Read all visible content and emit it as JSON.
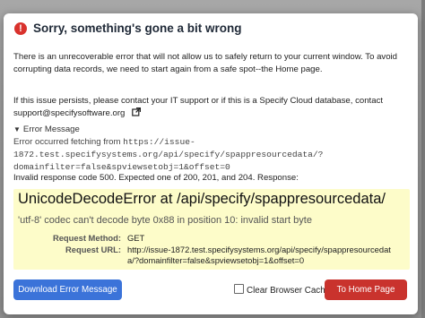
{
  "dialog": {
    "title": "Sorry, something's gone a bit wrong",
    "icon": "error-circle-icon",
    "paragraph1": "There is an unrecoverable error that will not allow us to safely return to your current window. To avoid corrupting data records, we need to start again from a safe spot--the Home page.",
    "paragraph2": "If this issue persists, please contact your IT support or if this is a Specify Cloud database, contact",
    "support_email": "support@specifysoftware.org",
    "details_summary": "Error Message",
    "fetch_prefix": "Error occurred fetching from",
    "fetch_url": "https://issue-1872.test.specifysystems.org/api/specify/spappresourcedata/?domainfilter=false&spviewsetobj=1&offset=0",
    "invalid_response": "Invalid response code 500. Expected one of 200, 201, and 204. Response:",
    "exception": {
      "title": "UnicodeDecodeError at /api/specify/spappresourcedata/",
      "message": "'utf-8' codec can't decode byte 0x88 in position 10: invalid start byte",
      "request_method_label": "Request Method:",
      "request_method_value": "GET",
      "request_url_label": "Request URL:",
      "request_url_value": "http://issue-1872.test.specifysystems.org/api/specify/spappresourcedata/?domainfilter=false&spviewsetobj=1&offset=0"
    }
  },
  "footer": {
    "download_label": "Download Error Message",
    "clear_cache_label": "Clear Browser Cache",
    "clear_cache_checked": false,
    "home_label": "To Home Page"
  },
  "colors": {
    "primary_blue": "#3b73d9",
    "danger_red": "#c9332d",
    "error_icon": "#d9322d",
    "error_panel_bg": "#fdfcc9"
  }
}
